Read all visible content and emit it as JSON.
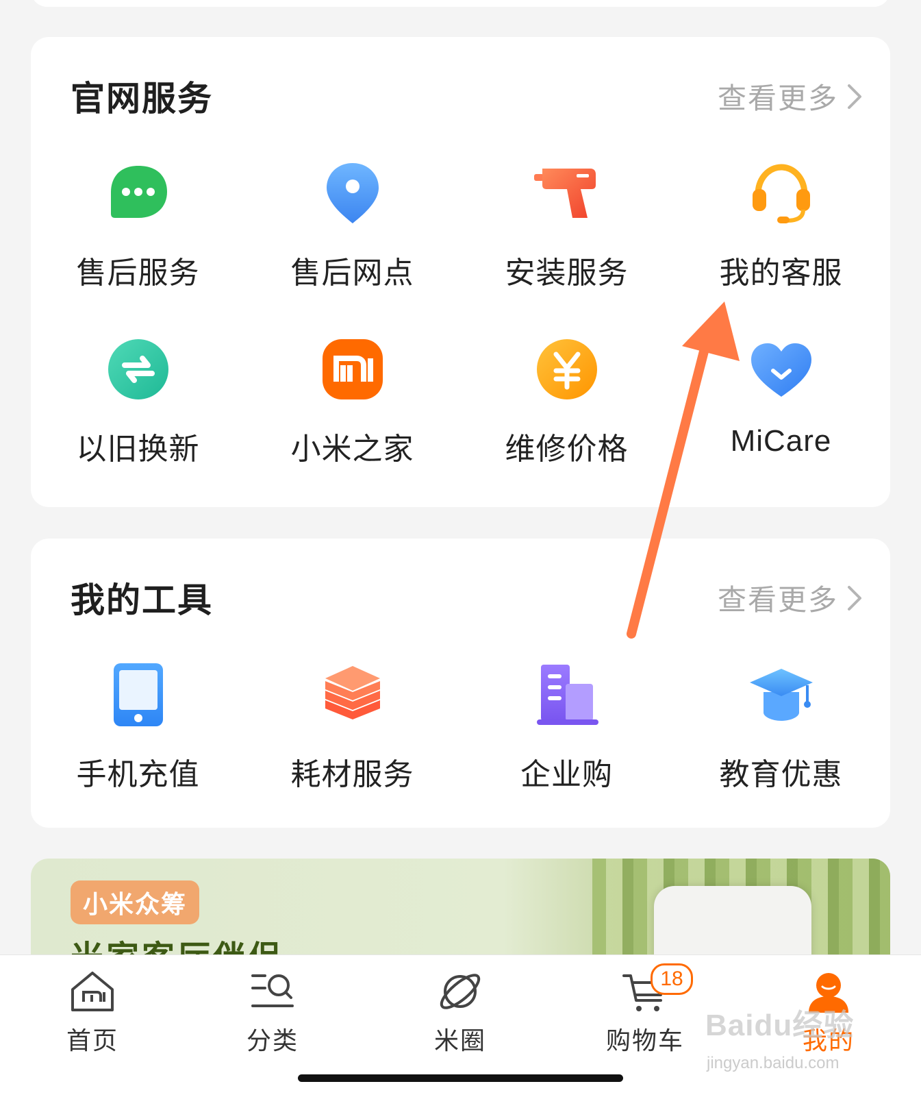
{
  "services": {
    "title": "官网服务",
    "more": "查看更多",
    "items": [
      {
        "label": "售后服务",
        "icon": "chat-bubble-icon"
      },
      {
        "label": "售后网点",
        "icon": "location-pin-icon"
      },
      {
        "label": "安装服务",
        "icon": "drill-icon"
      },
      {
        "label": "我的客服",
        "icon": "headset-icon"
      },
      {
        "label": "以旧换新",
        "icon": "exchange-icon"
      },
      {
        "label": "小米之家",
        "icon": "mi-logo-icon"
      },
      {
        "label": "维修价格",
        "icon": "yuan-coin-icon"
      },
      {
        "label": "MiCare",
        "icon": "heart-icon"
      }
    ]
  },
  "tools": {
    "title": "我的工具",
    "more": "查看更多",
    "items": [
      {
        "label": "手机充值",
        "icon": "phone-icon"
      },
      {
        "label": "耗材服务",
        "icon": "layers-icon"
      },
      {
        "label": "企业购",
        "icon": "building-icon"
      },
      {
        "label": "教育优惠",
        "icon": "graduation-cap-icon"
      }
    ]
  },
  "banner": {
    "tag": "小米众筹",
    "headline": "米家客厅伴侣"
  },
  "tabbar": {
    "items": [
      {
        "label": "首页",
        "icon": "home-icon"
      },
      {
        "label": "分类",
        "icon": "category-search-icon"
      },
      {
        "label": "米圈",
        "icon": "planet-icon"
      },
      {
        "label": "购物车",
        "icon": "cart-icon",
        "badge": "18"
      },
      {
        "label": "我的",
        "icon": "profile-icon"
      }
    ],
    "active_tab": "我的"
  },
  "watermark": {
    "main": "Baidu经验",
    "sub": "jingyan.baidu.com"
  },
  "colors": {
    "accent": "#ff6a00",
    "annotation_arrow": "#ff7a45"
  }
}
